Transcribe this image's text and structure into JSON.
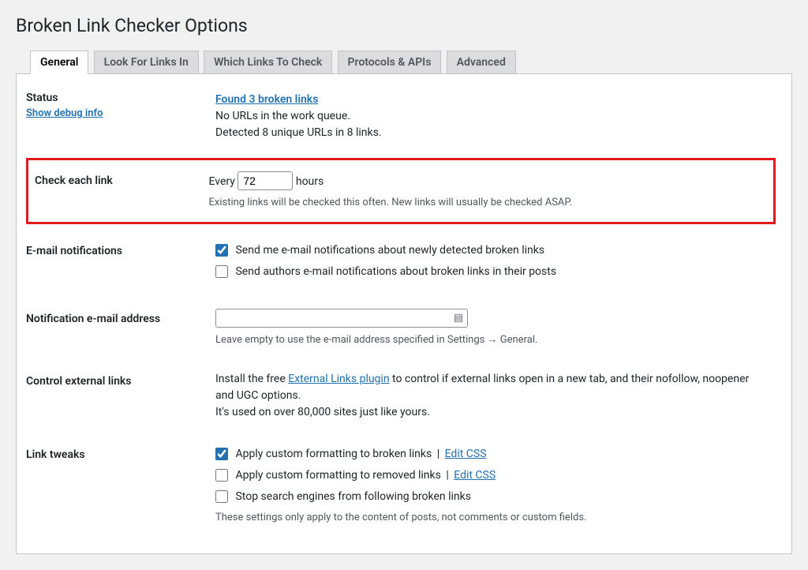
{
  "page_title": "Broken Link Checker Options",
  "tabs": [
    {
      "label": "General",
      "active": true
    },
    {
      "label": "Look For Links In",
      "active": false
    },
    {
      "label": "Which Links To Check",
      "active": false
    },
    {
      "label": "Protocols & APIs",
      "active": false
    },
    {
      "label": "Advanced",
      "active": false
    }
  ],
  "status": {
    "heading": "Status",
    "debug_link": "Show debug info",
    "found_link": "Found 3 broken links",
    "queue_line": "No URLs in the work queue.",
    "detected_line": "Detected 8 unique URLs in 8 links."
  },
  "check_each": {
    "heading": "Check each link",
    "prefix": "Every",
    "value": "72",
    "suffix": "hours",
    "desc": "Existing links will be checked this often. New links will usually be checked ASAP."
  },
  "email_notify": {
    "heading": "E-mail notifications",
    "opt1": "Send me e-mail notifications about newly detected broken links",
    "opt2": "Send authors e-mail notifications about broken links in their posts"
  },
  "notify_addr": {
    "heading": "Notification e-mail address",
    "value": "",
    "desc": "Leave empty to use the e-mail address specified in Settings → General."
  },
  "external": {
    "heading": "Control external links",
    "pre": "Install the free ",
    "link": "External Links plugin",
    "post": " to control if external links open in a new tab, and their nofollow, noopener and UGC options.",
    "line2": "It's used on over 80,000 sites just like yours."
  },
  "tweaks": {
    "heading": "Link tweaks",
    "opt1": "Apply custom formatting to broken links",
    "edit_css": "Edit CSS",
    "opt2": "Apply custom formatting to removed links",
    "opt3": "Stop search engines from following broken links",
    "desc": "These settings only apply to the content of posts, not comments or custom fields."
  }
}
